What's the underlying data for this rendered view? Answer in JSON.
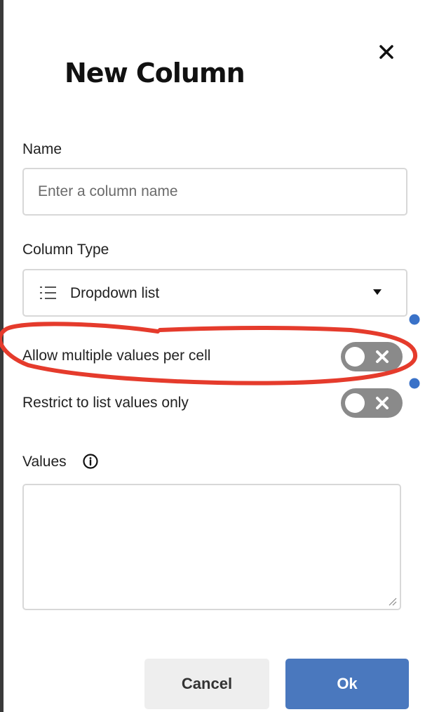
{
  "dialog": {
    "title": "New Column",
    "close_icon": "close-icon"
  },
  "name_field": {
    "label": "Name",
    "value": "",
    "placeholder": "Enter a column name"
  },
  "column_type": {
    "label": "Column Type",
    "icon": "list-icon",
    "selected": "Dropdown list"
  },
  "toggles": [
    {
      "label": "Allow multiple values per cell",
      "enabled": false
    },
    {
      "label": "Restrict to list values only",
      "enabled": false
    }
  ],
  "values_field": {
    "label": "Values",
    "info_icon": "info-icon",
    "value": ""
  },
  "buttons": {
    "cancel": "Cancel",
    "ok": "Ok"
  },
  "colors": {
    "primary": "#4a78be",
    "toggle_off": "#8a8a8a",
    "annotation": "#e53b2c",
    "handle": "#3a72c8"
  }
}
